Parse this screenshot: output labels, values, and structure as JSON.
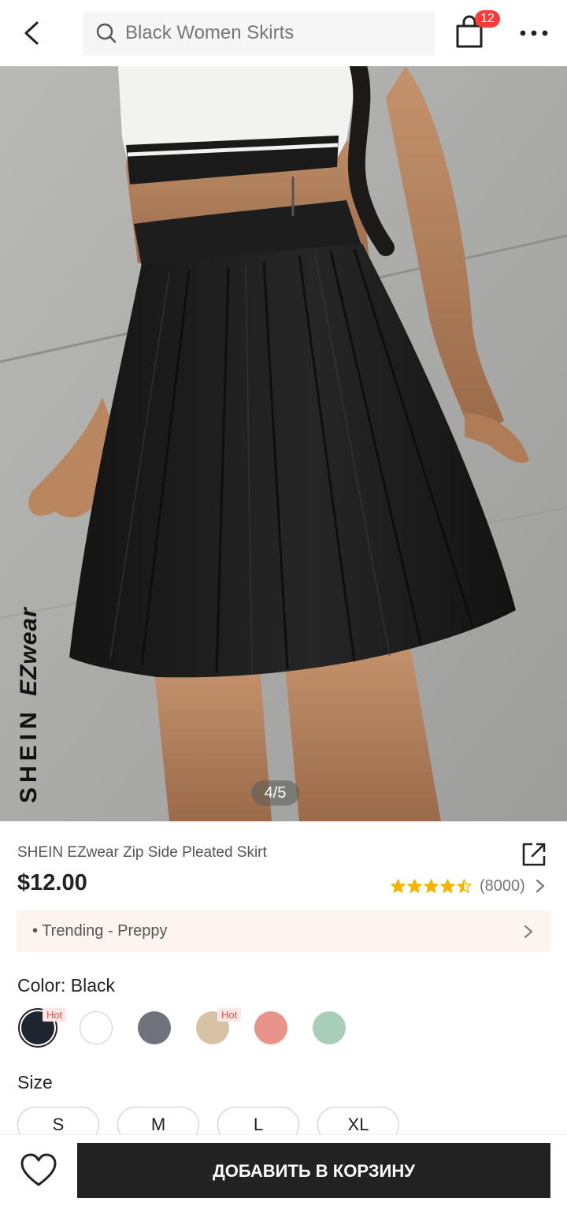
{
  "header": {
    "search_value": "Black Women Skirts",
    "cart_badge": "12",
    "icons": {
      "back": "chevron-left-icon",
      "search": "search-icon",
      "cart": "shopping-bag-icon",
      "more": "more-horizontal-icon"
    }
  },
  "gallery": {
    "brand_watermark_main": "SHEIN",
    "brand_watermark_sub": "EZwear",
    "page_indicator": "4/5"
  },
  "product": {
    "title": "SHEIN EZwear Zip Side Pleated Skirt",
    "price": "$12.00",
    "rating_value": 4.5,
    "rating_max": 5,
    "rating_count": "(8000)",
    "star_color": "#f5b400"
  },
  "trend": {
    "text": "• Trending - Preppy"
  },
  "color": {
    "label": "Color: Black",
    "swatches": [
      {
        "color": "#1e2530",
        "selected": true,
        "hot": "Hot"
      },
      {
        "color": "#ffffff",
        "selected": false,
        "hot": ""
      },
      {
        "color": "#6f737b",
        "selected": false,
        "hot": ""
      },
      {
        "color": "#d8c2a6",
        "selected": false,
        "hot": "Hot"
      },
      {
        "color": "#e9948a",
        "selected": false,
        "hot": ""
      },
      {
        "color": "#a8cdb8",
        "selected": false,
        "hot": ""
      }
    ]
  },
  "size": {
    "label": "Size",
    "options": [
      "S",
      "M",
      "L",
      "XL"
    ]
  },
  "bottom": {
    "add_to_cart": "ДОБАВИТЬ В КОРЗИНУ"
  }
}
